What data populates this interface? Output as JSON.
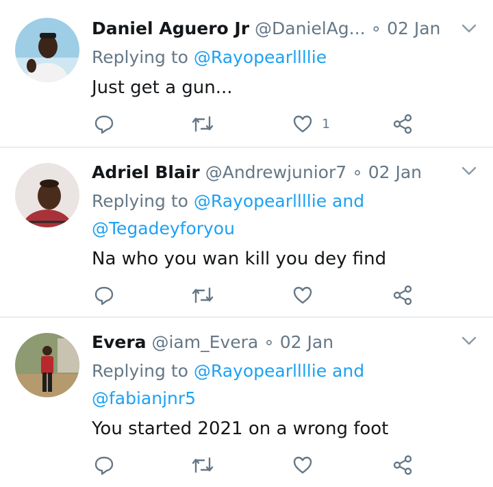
{
  "tweets": [
    {
      "name": "Daniel Aguero Jr",
      "handle": "@DanielAg...",
      "dot": "∘",
      "date": "02 Jan",
      "replying_prefix": "Replying to ",
      "mention1": "@Rayopearllllie",
      "mention_joiner": "",
      "mention2": "",
      "text": "Just get a gun...",
      "likes": "1",
      "avatar_colors": {
        "bg": "#9ecde6",
        "skin": "#3b2418",
        "shirt": "#f2f2f2"
      }
    },
    {
      "name": "Adriel Blair",
      "handle": "@Andrewjunior7",
      "dot": "∘",
      "date": "02 Jan",
      "replying_prefix": "Replying to ",
      "mention1": "@Rayopearllllie",
      "mention_joiner": " and",
      "mention2": "@Tegadeyforyou",
      "text": "Na who you wan kill you dey find",
      "likes": "",
      "avatar_colors": {
        "bg": "#eae4e2",
        "skin": "#4a2c1c",
        "shirt": "#a8323a"
      }
    },
    {
      "name": "Evera",
      "handle": "@iam_Evera",
      "dot": "∘",
      "date": "02 Jan",
      "replying_prefix": "Replying to ",
      "mention1": "@Rayopearllllie",
      "mention_joiner": " and",
      "mention2": "@fabianjnr5",
      "text": "You started 2021 on a wrong foot",
      "likes": "",
      "avatar_colors": {
        "bg": "#8d9a72",
        "skin": "#3a2418",
        "shirt": "#b8282c"
      }
    }
  ],
  "icons": [
    "reply-icon",
    "retweet-icon",
    "like-icon",
    "share-icon",
    "chevron-down-icon"
  ],
  "colors": {
    "text": "#14171a",
    "muted": "#657786",
    "link": "#1da1f2",
    "divider": "#e6ecf0"
  }
}
